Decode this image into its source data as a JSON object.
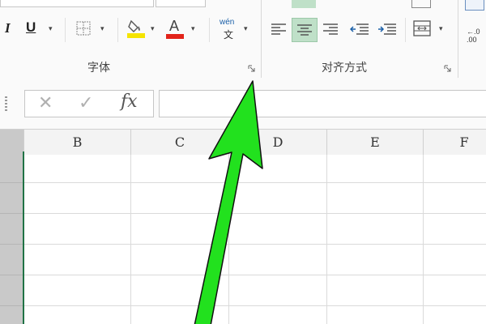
{
  "ribbon": {
    "font_group_label": "字体",
    "align_group_label": "对齐方式",
    "buttons": {
      "italic": "I",
      "underline": "U",
      "font_color": "A",
      "phonetic_top": "wén",
      "phonetic_bottom": "文"
    }
  },
  "formula_bar": {
    "cancel": "✕",
    "enter": "✓",
    "function": "fx",
    "value": ""
  },
  "columns": [
    "B",
    "C",
    "D",
    "E",
    "F"
  ],
  "colors": {
    "fill_highlight": "#f5e400",
    "font_red": "#e2231a",
    "active_align": "#bfe0c8",
    "arrow_green": "#22e11e",
    "selection_border": "#217346"
  },
  "annotation": "green-arrow pointing to font group dialog launcher"
}
